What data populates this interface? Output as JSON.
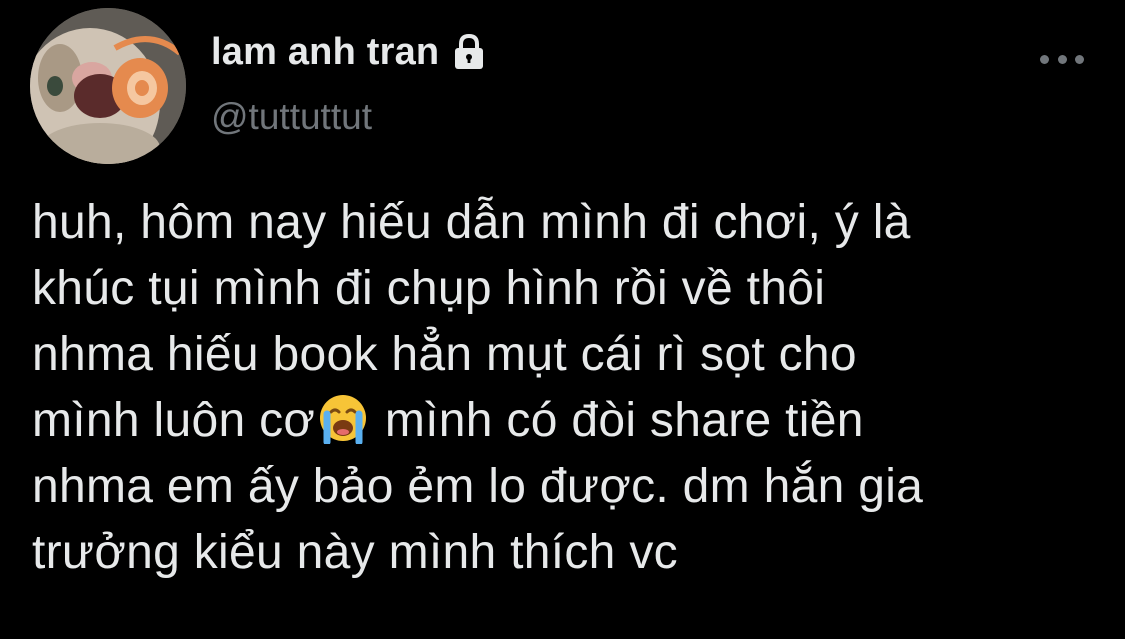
{
  "tweet": {
    "author": {
      "display_name": "lam anh tran",
      "handle": "@tuttuttut",
      "protected_icon": "lock-icon",
      "avatar_icon": "cat-avatar"
    },
    "more_icon": "more-horizontal-icon",
    "text_lines": [
      {
        "text": "huh, hôm nay hiếu dẫn mình đi chơi, ý là"
      },
      {
        "text": "khúc tụi mình đi chụp hình rồi về thôi"
      },
      {
        "text": "nhma hiếu book hẳn mụt cái rì sọt cho"
      },
      {
        "before": "mình luôn cơ",
        "emoji": "loudly-crying-face-icon",
        "after": " mình có đòi share tiền"
      },
      {
        "text": "nhma em ấy bảo ẻm lo được. dm hắn gia"
      },
      {
        "text": "trưởng kiểu này mình thích vc"
      }
    ],
    "colors": {
      "background": "#000000",
      "primary_text": "#e7e9ea",
      "secondary_text": "#71767b"
    }
  }
}
